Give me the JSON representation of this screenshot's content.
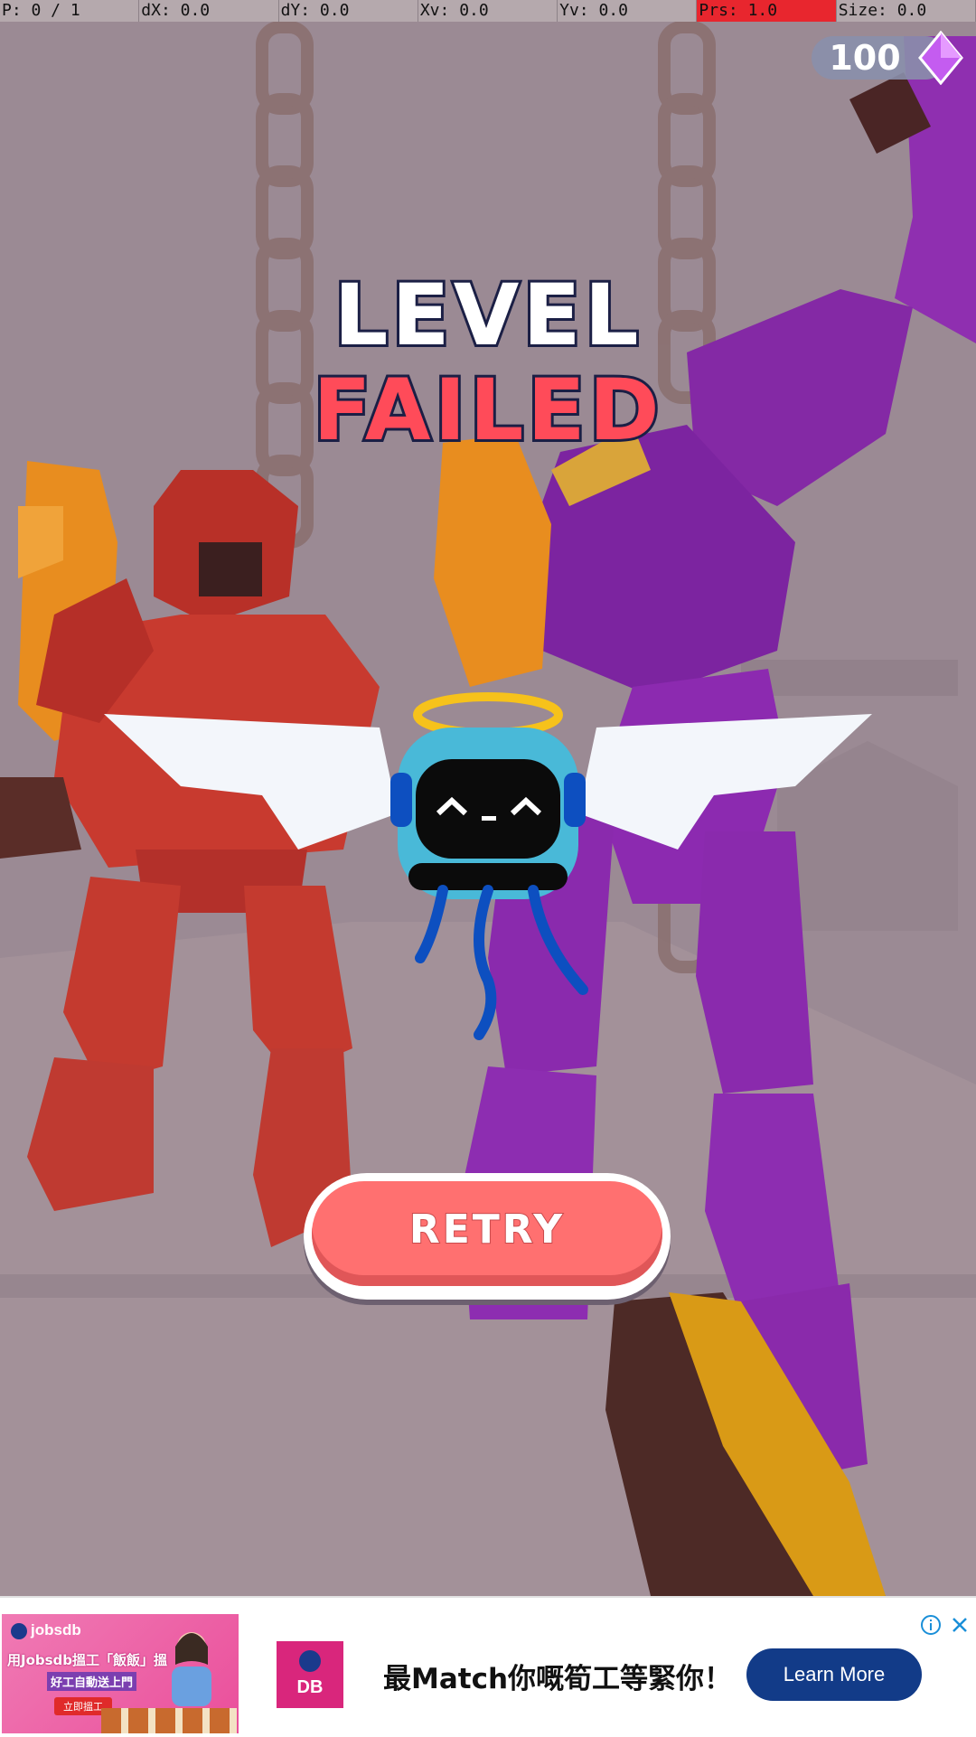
{
  "debug_bar": {
    "pointer": "P: 0 / 1",
    "dx": "dX: 0.0",
    "dy": "dY: 0.0",
    "xv": "Xv: 0.0",
    "yv": "Yv: 0.0",
    "pressure": "Prs: 1.0",
    "size": "Size: 0.0",
    "highlight_color": "#e8262e"
  },
  "hud": {
    "gem_count": "100",
    "gem_icon": "purple-diamond-icon"
  },
  "result": {
    "title_line1": "LEVEL",
    "title_line2": "FAILED",
    "title_color_line1": "#ffffff",
    "title_color_line2": "#ff4b59",
    "mascot": "angel-jellyfish-robot"
  },
  "actions": {
    "retry_label": "RETRY",
    "retry_color": "#ff7070"
  },
  "ad": {
    "brand": "jobsdb",
    "image_text_1": "用Jobsdb搵工「飯飯」搵",
    "image_text_2": "好工自動送上門",
    "image_button": "立即搵工",
    "logo_text": "DB",
    "headline": "最Match你嘅筍工等緊你！",
    "cta_label": "Learn More",
    "cta_color": "#123b88",
    "info_icon": "info-icon",
    "close_icon": "close-icon"
  }
}
